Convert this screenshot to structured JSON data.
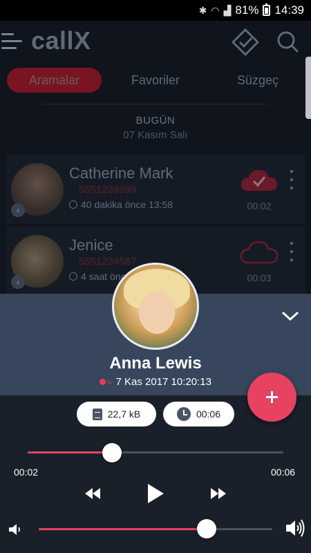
{
  "status_bar": {
    "battery": "81%",
    "time": "14:39"
  },
  "app": {
    "title": "callX"
  },
  "tabs": [
    {
      "label": "Aramalar",
      "active": true
    },
    {
      "label": "Favoriler",
      "active": false
    },
    {
      "label": "Süzgeç",
      "active": false
    }
  ],
  "date_header": {
    "label": "BUGÜN",
    "date": "07 Kasım Salı"
  },
  "calls": [
    {
      "name": "Catherine Mark",
      "number": "5551239999",
      "meta": "40 dakika önce 13:58",
      "duration": "00:02",
      "saved": true
    },
    {
      "name": "Jenice",
      "number": "5551234567",
      "meta": "4 saat önce",
      "duration": "00:03",
      "saved": false
    }
  ],
  "player": {
    "contact_name": "Anna Lewis",
    "call_info": "7 Kas 2017 10:20:13",
    "file_size": "22,7 kB",
    "length": "00:06",
    "current_time": "00:02",
    "total_time": "00:06",
    "progress": 0.33,
    "volume": 0.72
  },
  "colors": {
    "accent": "#e64261",
    "sheet_header": "#37465c",
    "sheet_bg": "#1a2029"
  }
}
